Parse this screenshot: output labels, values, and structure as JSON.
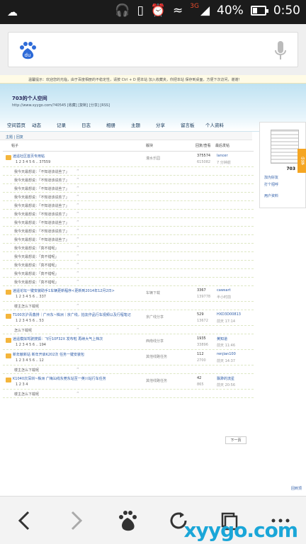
{
  "status": {
    "signal_label": "3G",
    "battery_percent": "40%",
    "battery_level": 0.4,
    "time": "0:50"
  },
  "browser": {
    "search_placeholder": "",
    "logo_label": "du"
  },
  "page": {
    "notice": "温馨提示：欢迎您的光临，由于百度相册的不稳定性，请按 Ctrl + D 把本站 加入收藏夹，你把本站 保存到桌面，方便下次访问，谢谢！",
    "blog_title": "703的个人空间",
    "blog_url": "http://www.xyygo.com/?40545 [收藏] [复制] [分享] [RSS]",
    "nav": [
      "空间首页",
      "动态",
      "记录",
      "日志",
      "相册",
      "主题",
      "分享",
      "留言板",
      "个人资料"
    ],
    "breadcrumb": "主题 | 回复",
    "table_head": {
      "topic": "帖子",
      "forum": "版块",
      "stats": "回复/查看",
      "last": "最后发帖"
    },
    "rows": [
      {
        "type": "big",
        "title": "逍遥社区首页专用帖",
        "pages": "1 2 3 4 5 6 .. 37559",
        "mid": "灌水乐园",
        "c1": "375574",
        "c2": "615082",
        "l1": "lancer",
        "l2": "7 分钟前"
      },
      {
        "type": "small",
        "title": "我今天最想说：「不知道该说些了」",
        "q": "”"
      },
      {
        "type": "small",
        "title": "我今天最想说：「不知道该说些了」",
        "q": "”"
      },
      {
        "type": "small",
        "title": "我今天最想说：「不知道该说些了」",
        "q": "”"
      },
      {
        "type": "small",
        "title": "我今天最想说：「不知道该说些了」",
        "q": "”"
      },
      {
        "type": "small",
        "title": "我今天最想说：「不知道该说些了」",
        "q": "”"
      },
      {
        "type": "small",
        "title": "我今天最想说：「不知道该说些了」",
        "q": "”"
      },
      {
        "type": "small",
        "title": "我今天最想说：「不知道该说些了」",
        "q": "”"
      },
      {
        "type": "small",
        "title": "我今天最想说：「不知道该说些了」",
        "q": "”"
      },
      {
        "type": "small",
        "title": "我今天最想说：「不知道该说些了」",
        "q": "”"
      },
      {
        "type": "small",
        "title": "我今天最想说：「真不错呢」",
        "q": "”"
      },
      {
        "type": "small",
        "title": "我今天最想说：「真不错呢」",
        "q": "”"
      },
      {
        "type": "small",
        "title": "我今天最想说：「真不错呢」",
        "q": "”"
      },
      {
        "type": "small",
        "title": "我今天最想说：「真不错呢」",
        "q": "”"
      },
      {
        "type": "small",
        "title": "我今天最想说：「真不错呢」",
        "q": "”"
      },
      {
        "type": "big",
        "title": "逍遥论坛一键安装助手1车辆更新程序<更新到2014年12月2日>",
        "pages": "1 2 3 4 5 6 .. 337",
        "mid": "车辆下载",
        "c1": "3367",
        "c2": "139778",
        "l1": "cawsart",
        "l2": "半小时前"
      },
      {
        "type": "small",
        "title": "楼主怎么下载呢",
        "q": "”"
      },
      {
        "type": "big",
        "title": "T100次沪青鑫排｜广州东~株洲｜京广线，拍友作品行车视频以及行程笔记",
        "pages": "1 2 3 4 5 6 .. 53",
        "mid": "京广线分享",
        "c1": "529",
        "c2": "13672",
        "l1": "HXD3D00813",
        "l2": "前天 17:14"
      },
      {
        "type": "small",
        "title": "怎么下载呢",
        "q": "”"
      },
      {
        "type": "big",
        "title": "逍遥模拟驾驶搜狐：飞行10F32X 发布啦 再续大气上档次",
        "pages": "1 2 3 4 5 6 .. 194",
        "mid": "西南线分享",
        "c1": "1935",
        "c2": "33896",
        "l1": "黄知道",
        "l2": "前天 11:46"
      },
      {
        "type": "big",
        "title": "新年献新站 新年开启K202次 任务一键安装包",
        "pages": "1 2 3 4 5 6 .. 12",
        "mid": "其他线路任务",
        "c1": "112",
        "c2": "2700",
        "l1": "renjian100",
        "l2": "前天 14:37"
      },
      {
        "type": "small",
        "title": "楼主怎么下载呢",
        "q": "”"
      },
      {
        "type": "big",
        "title": "K1040次深圳~株洲 广梅汕线东莞东站至一英川站行车任务",
        "pages": "1 2 3 4",
        "mid": "其他线路任务",
        "c1": "42",
        "c2": "865",
        "l1": "飘渺的流星",
        "l2": "前天 20:56"
      },
      {
        "type": "small",
        "title": "楼主怎么下载呢",
        "q": "”"
      }
    ],
    "next_label": "下一页",
    "sidebar_user": "703",
    "sidebar_act1": "加为好友",
    "sidebar_act2": "打个招呼",
    "sidebar_info": "用户资料",
    "share_tab": "分享",
    "footer_link": "回到顶"
  },
  "watermark": "xyygo.com",
  "colors": {
    "accent": "#2b5aa6",
    "status_bg": "#1b1b1b",
    "watermark": "#1aa6d8"
  }
}
